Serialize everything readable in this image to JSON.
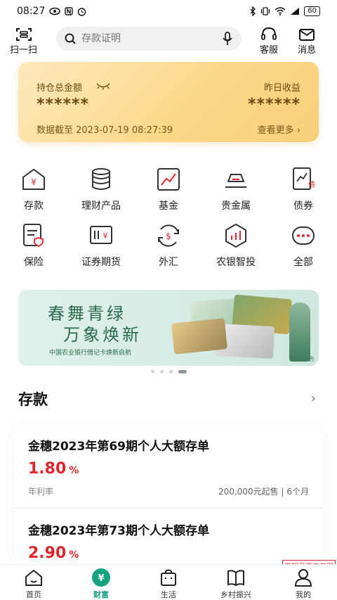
{
  "status_bar": {
    "time": "08:27",
    "battery": "60"
  },
  "top_bar": {
    "scan_label": "扫一扫",
    "search_placeholder": "存款证明",
    "service_label": "客服",
    "message_label": "消息"
  },
  "asset_card": {
    "total_label": "持仓总金额",
    "total_value": "******",
    "yesterday_label": "昨日收益",
    "yesterday_value": "******",
    "date_text": "数据截至 2023-07-19 08:27:39",
    "more_text": "查看更多"
  },
  "grid": {
    "items": [
      {
        "label": "存款",
        "icon": "deposit-icon"
      },
      {
        "label": "理财产品",
        "icon": "wealth-icon"
      },
      {
        "label": "基金",
        "icon": "fund-icon"
      },
      {
        "label": "贵金属",
        "icon": "gold-icon"
      },
      {
        "label": "债券",
        "icon": "bond-icon"
      },
      {
        "label": "保险",
        "icon": "insurance-icon"
      },
      {
        "label": "证券期货",
        "icon": "securities-icon"
      },
      {
        "label": "外汇",
        "icon": "forex-icon"
      },
      {
        "label": "农银智投",
        "icon": "smart-invest-icon"
      },
      {
        "label": "全部",
        "icon": "more-icon"
      }
    ]
  },
  "banner": {
    "title_line1": "春舞青绿",
    "title_line2": "万象焕新",
    "subtitle": "中国农业银行借记卡焕新启航",
    "ad_tag": "广告"
  },
  "deposit_section": {
    "title": "存款",
    "products": [
      {
        "name": "金穗2023年第69期个人大额存单",
        "rate": "1.80",
        "rate_unit": "%",
        "rate_label": "年利率",
        "terms": "200,000元起售 | 6个月"
      },
      {
        "name": "金穗2023年第73期个人大额存单",
        "rate": "2.90",
        "rate_unit": "%"
      }
    ]
  },
  "watermark": "掌银界面示意图",
  "tab_bar": {
    "tabs": [
      {
        "label": "首页",
        "icon": "home-icon"
      },
      {
        "label": "财富",
        "icon": "wealth-tab-icon",
        "active": true
      },
      {
        "label": "生活",
        "icon": "bag-icon"
      },
      {
        "label": "乡村振兴",
        "icon": "book-icon"
      },
      {
        "label": "我的",
        "icon": "person-icon"
      }
    ]
  },
  "colors": {
    "accent_green": "#14a37f",
    "rate_red": "#e0262d",
    "card_gold": "#fbd98a"
  }
}
